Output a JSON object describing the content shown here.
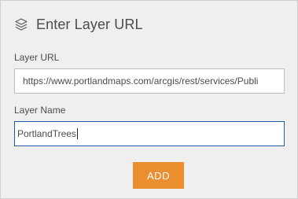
{
  "header": {
    "icon": "layers-icon",
    "title": "Enter Layer URL"
  },
  "form": {
    "url_label": "Layer URL",
    "url_value": "https://www.portlandmaps.com/arcgis/rest/services/Publi­",
    "name_label": "Layer Name",
    "name_value": "PortlandTrees"
  },
  "actions": {
    "add_label": "ADD"
  },
  "colors": {
    "accent": "#ea8e2f",
    "focus_border": "#1f5fa6",
    "panel_bg": "#efefef",
    "text": "#4c4c4c"
  }
}
